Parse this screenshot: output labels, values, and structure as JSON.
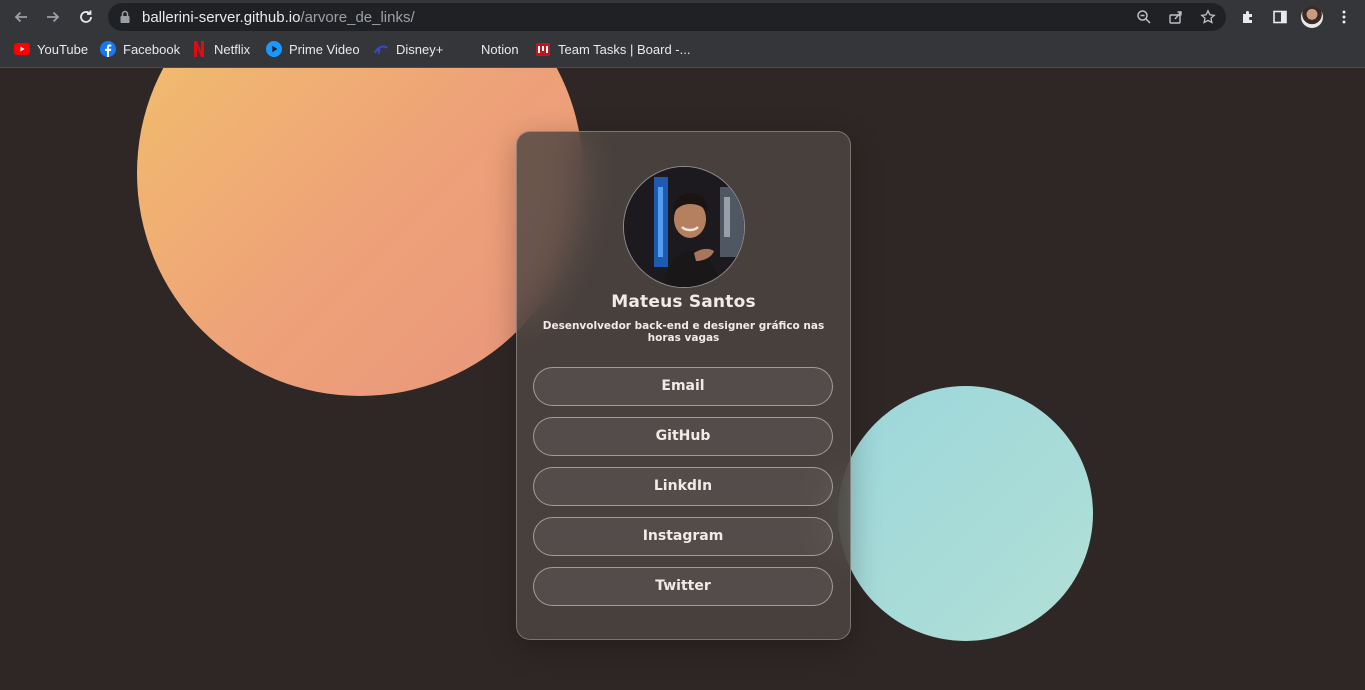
{
  "browser": {
    "url_domain": "ballerini-server.github.io",
    "url_path": "/arvore_de_links/",
    "bookmarks": [
      {
        "label": "YouTube",
        "icon": "youtube-icon"
      },
      {
        "label": "Facebook",
        "icon": "facebook-icon"
      },
      {
        "label": "Netflix",
        "icon": "netflix-icon"
      },
      {
        "label": "Prime Video",
        "icon": "prime-video-icon"
      },
      {
        "label": "Disney+",
        "icon": "disney-plus-icon"
      },
      {
        "label": "Notion",
        "icon": "notion-icon"
      },
      {
        "label": "Team Tasks | Board -...",
        "icon": "team-tasks-icon"
      }
    ]
  },
  "profile": {
    "name": "Mateus Santos",
    "bio": "Desenvolvedor back-end e designer gráfico nas horas vagas"
  },
  "links": [
    {
      "label": "Email"
    },
    {
      "label": "GitHub"
    },
    {
      "label": "LinkdIn"
    },
    {
      "label": "Instagram"
    },
    {
      "label": "Twitter"
    }
  ],
  "colors": {
    "page_background": "#2e2725",
    "orange_circle": "#eea278",
    "teal_circle": "#a8dcd8",
    "card_background": "#4e4642",
    "text": "#f1ebe8"
  }
}
